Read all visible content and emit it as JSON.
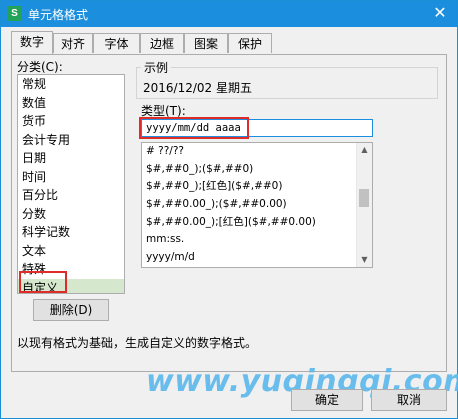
{
  "window": {
    "title": "单元格格式",
    "app_icon_letter": "S",
    "close_glyph": "✕"
  },
  "tabs": [
    {
      "label": "数字",
      "active": true
    },
    {
      "label": "对齐",
      "active": false
    },
    {
      "label": "字体",
      "active": false
    },
    {
      "label": "边框",
      "active": false
    },
    {
      "label": "图案",
      "active": false
    },
    {
      "label": "保护",
      "active": false
    }
  ],
  "category": {
    "label": "分类(C):",
    "items": [
      "常规",
      "数值",
      "货币",
      "会计专用",
      "日期",
      "时间",
      "百分比",
      "分数",
      "科学记数",
      "文本",
      "特殊",
      "自定义"
    ],
    "selected": "自定义"
  },
  "delete_button": "删除(D)",
  "sample": {
    "caption": "示例",
    "value": "2016/12/02 星期五"
  },
  "type": {
    "label": "类型(T):",
    "value": "yyyy/mm/dd aaaa"
  },
  "format_list": [
    "# ??/??",
    "$#,##0_);($#,##0)",
    "$#,##0_);[红色]($#,##0)",
    "$#,##0.00_);($#,##0.00)",
    "$#,##0.00_);[红色]($#,##0.00)",
    "mm:ss.",
    "yyyy/m/d"
  ],
  "description": "以现有格式为基础，生成自定义的数字格式。",
  "buttons": {
    "ok": "确定",
    "cancel": "取消"
  },
  "watermark": "www.yuqingqi.com",
  "colors": {
    "titlebar": "#1b8fde",
    "highlight_red": "#e02b2b",
    "selected_item_bg": "#d5e8ce",
    "watermark": "#5bb8ec"
  }
}
